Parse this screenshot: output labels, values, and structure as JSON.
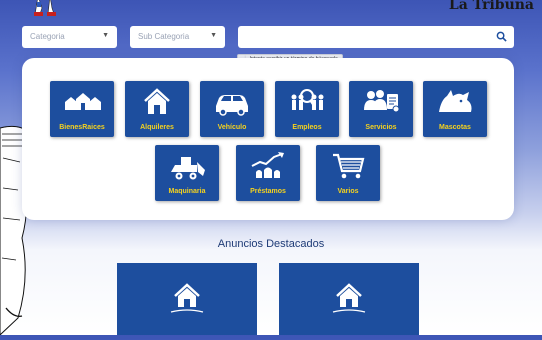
{
  "header": {
    "brand": "La Tribuna"
  },
  "filters": {
    "category": "Categoria",
    "subcategory": "Sub Categoria",
    "search_placeholder": "",
    "search_tooltip": "Intenta escribir un término de búsqueda"
  },
  "categories": [
    {
      "label": "BienesRaices",
      "icon": "houses-icon"
    },
    {
      "label": "Alquileres",
      "icon": "house-icon"
    },
    {
      "label": "Vehículo",
      "icon": "car-icon"
    },
    {
      "label": "Empleos",
      "icon": "people-search-icon"
    },
    {
      "label": "Servicios",
      "icon": "service-people-icon"
    },
    {
      "label": "Mascotas",
      "icon": "pets-icon"
    },
    {
      "label": "Maquinaria",
      "icon": "bulldozer-icon"
    },
    {
      "label": "Préstamos",
      "icon": "money-chart-icon"
    },
    {
      "label": "Varios",
      "icon": "shopping-cart-icon"
    }
  ],
  "featured": {
    "title": "Anuncios Destacados"
  },
  "colors": {
    "tile": "#1d4e9e",
    "tile_label": "#f5d21e",
    "heading": "#1f3c77"
  }
}
